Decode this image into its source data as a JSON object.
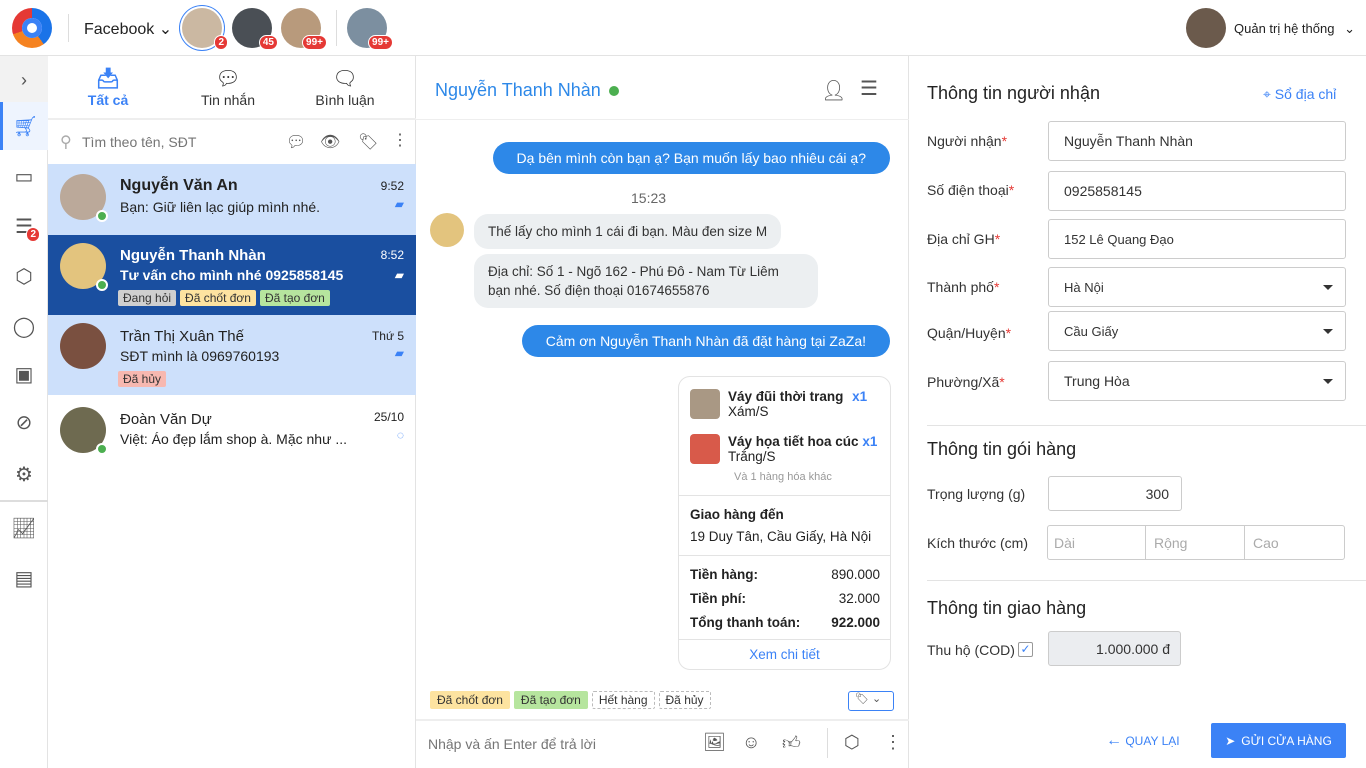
{
  "header": {
    "channel": "Facebook",
    "page_badges": [
      "2",
      "45",
      "99+",
      "99+"
    ],
    "user": "Quản trị hệ thống"
  },
  "rail": {
    "notes_badge": "2"
  },
  "list": {
    "tabs": [
      "Tất cả",
      "Tin nhắn",
      "Bình luận"
    ],
    "search_placeholder": "Tìm theo tên, SĐT",
    "conversations": [
      {
        "name": "Nguyễn Văn An",
        "msg": "Bạn: Giữ liên lạc giúp mình nhé.",
        "time": "9:52",
        "tags": []
      },
      {
        "name": "Nguyễn Thanh Nhàn",
        "msg": "Tư vấn cho mình nhé 0925858145",
        "time": "8:52",
        "tags": [
          "Đang hỏi",
          "Đã chốt đơn",
          "Đã tạo đơn"
        ]
      },
      {
        "name": "Trần Thị Xuân Thế",
        "msg": "SĐT mình là 0969760193",
        "time": "Thứ 5",
        "tags": [
          "Đã hủy"
        ]
      },
      {
        "name": "Đoàn Văn Dự",
        "msg": "Việt: Áo đẹp lắm shop à. Mặc như ...",
        "time": "25/10",
        "tags": []
      }
    ]
  },
  "chat": {
    "title": "Nguyễn Thanh Nhàn",
    "messages": {
      "out1": "Dạ bên mình còn bạn ạ? Bạn muốn lấy bao nhiêu cái ạ?",
      "time": "15:23",
      "in1": "Thế lấy cho mình 1 cái đi bạn. Màu đen size M",
      "in2": "Địa chỉ: Số 1 - Ngõ 162 - Phú Đô - Nam Từ Liêm bạn nhé. Số điện thoại 01674655876",
      "out2": "Cảm ơn Nguyễn Thanh Nhàn đã đặt hàng tại ZaZa!"
    },
    "order": {
      "items": [
        {
          "name": "Váy đũi thời trang",
          "qty": "x1",
          "variant": "Xám/S"
        },
        {
          "name": "Váy họa tiết hoa cúc",
          "qty": "x1",
          "variant": "Trắng/S"
        }
      ],
      "more": "Và 1 hàng hóa khác",
      "ship_label": "Giao hàng đến",
      "ship_addr": "19 Duy Tân, Cầu Giấy, Hà Nội",
      "goods_label": "Tiền hàng:",
      "goods": "890.000",
      "fee_label": "Tiền phí:",
      "fee": "32.000",
      "total_label": "Tổng thanh toán:",
      "total": "922.000",
      "detail": "Xem chi tiết"
    },
    "quick_tags": [
      "Đã chốt đơn",
      "Đã tạo đơn",
      "Hết hàng",
      "Đã hủy"
    ],
    "input_placeholder": "Nhập và ấn Enter để trả lời"
  },
  "form": {
    "recipient_title": "Thông tin người nhận",
    "address_book": "Sổ địa chỉ",
    "fields": [
      {
        "label": "Người nhận",
        "value": "Nguyễn Thanh Nhàn"
      },
      {
        "label": "Số điện thoại",
        "value": "0925858145"
      },
      {
        "label": "Địa chỉ GH",
        "value": "152 Lê Quang Đạo"
      },
      {
        "label": "Thành phố",
        "value": "Hà Nội"
      },
      {
        "label": "Quận/Huyện",
        "value": "Cầu Giấy"
      },
      {
        "label": "Phường/Xã",
        "value": "Trung Hòa"
      }
    ],
    "package_title": "Thông tin gói hàng",
    "weight_label": "Trọng lượng (g)",
    "weight": "300",
    "size_label": "Kích thước (cm)",
    "size_placeholders": [
      "Dài",
      "Rộng",
      "Cao"
    ],
    "delivery_title": "Thông tin giao hàng",
    "cod_label": "Thu hộ (COD)",
    "cod": "1.000.000 đ",
    "back": "QUAY LẠI",
    "submit": "GỬI CỬA HÀNG"
  }
}
